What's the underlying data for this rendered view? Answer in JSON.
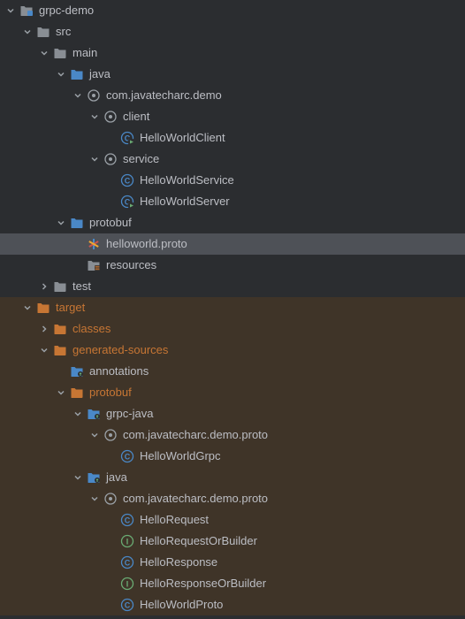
{
  "tree": [
    {
      "id": "root",
      "indent": 0,
      "chev": "down",
      "icon": "module",
      "label": "grpc-demo"
    },
    {
      "id": "src",
      "indent": 1,
      "chev": "down",
      "icon": "folder",
      "label": "src"
    },
    {
      "id": "main",
      "indent": 2,
      "chev": "down",
      "icon": "folder",
      "label": "main"
    },
    {
      "id": "java",
      "indent": 3,
      "chev": "down",
      "icon": "folder-source",
      "label": "java"
    },
    {
      "id": "pkg1",
      "indent": 4,
      "chev": "down",
      "icon": "package",
      "label": "com.javatecharc.demo"
    },
    {
      "id": "client",
      "indent": 5,
      "chev": "down",
      "icon": "package",
      "label": "client"
    },
    {
      "id": "HelloWorldClient",
      "indent": 6,
      "chev": "none",
      "icon": "class-run",
      "label": "HelloWorldClient"
    },
    {
      "id": "service",
      "indent": 5,
      "chev": "down",
      "icon": "package",
      "label": "service"
    },
    {
      "id": "HelloWorldService",
      "indent": 6,
      "chev": "none",
      "icon": "class",
      "label": "HelloWorldService"
    },
    {
      "id": "HelloWorldServer",
      "indent": 6,
      "chev": "none",
      "icon": "class-run",
      "label": "HelloWorldServer"
    },
    {
      "id": "protobuf1",
      "indent": 3,
      "chev": "down",
      "icon": "folder-source",
      "label": "protobuf"
    },
    {
      "id": "helloworld",
      "indent": 4,
      "chev": "none",
      "icon": "proto",
      "label": "helloworld.proto",
      "selected": true
    },
    {
      "id": "resources",
      "indent": 4,
      "chev": "none",
      "icon": "folder-resources",
      "label": "resources"
    },
    {
      "id": "test",
      "indent": 2,
      "chev": "right",
      "icon": "folder",
      "label": "test"
    },
    {
      "id": "target",
      "indent": 1,
      "chev": "down",
      "icon": "folder-excluded",
      "label": "target",
      "excluded": true,
      "labelClass": "folder-orange"
    },
    {
      "id": "classes",
      "indent": 2,
      "chev": "right",
      "icon": "folder-excluded",
      "label": "classes",
      "excluded": true,
      "labelClass": "folder-orange"
    },
    {
      "id": "gensrc",
      "indent": 2,
      "chev": "down",
      "icon": "folder-excluded",
      "label": "generated-sources",
      "excluded": true,
      "labelClass": "folder-orange"
    },
    {
      "id": "annotations",
      "indent": 3,
      "chev": "none",
      "icon": "folder-generated",
      "label": "annotations",
      "excluded": true
    },
    {
      "id": "protobuf2",
      "indent": 3,
      "chev": "down",
      "icon": "folder-excluded",
      "label": "protobuf",
      "excluded": true,
      "labelClass": "folder-orange"
    },
    {
      "id": "grpcjava",
      "indent": 4,
      "chev": "down",
      "icon": "folder-generated",
      "label": "grpc-java",
      "excluded": true
    },
    {
      "id": "pkg2",
      "indent": 5,
      "chev": "down",
      "icon": "package",
      "label": "com.javatecharc.demo.proto",
      "excluded": true
    },
    {
      "id": "HelloWorldGrpc",
      "indent": 6,
      "chev": "none",
      "icon": "class",
      "label": "HelloWorldGrpc",
      "excluded": true
    },
    {
      "id": "java2",
      "indent": 4,
      "chev": "down",
      "icon": "folder-generated",
      "label": "java",
      "excluded": true
    },
    {
      "id": "pkg3",
      "indent": 5,
      "chev": "down",
      "icon": "package",
      "label": "com.javatecharc.demo.proto",
      "excluded": true
    },
    {
      "id": "HelloRequest",
      "indent": 6,
      "chev": "none",
      "icon": "class",
      "label": "HelloRequest",
      "excluded": true
    },
    {
      "id": "HelloRequestOrBuilder",
      "indent": 6,
      "chev": "none",
      "icon": "interface",
      "label": "HelloRequestOrBuilder",
      "excluded": true
    },
    {
      "id": "HelloResponse",
      "indent": 6,
      "chev": "none",
      "icon": "class",
      "label": "HelloResponse",
      "excluded": true
    },
    {
      "id": "HelloResponseOrBuilder",
      "indent": 6,
      "chev": "none",
      "icon": "interface",
      "label": "HelloResponseOrBuilder",
      "excluded": true
    },
    {
      "id": "HelloWorldProto",
      "indent": 6,
      "chev": "none",
      "icon": "class",
      "label": "HelloWorldProto",
      "excluded": true
    }
  ]
}
